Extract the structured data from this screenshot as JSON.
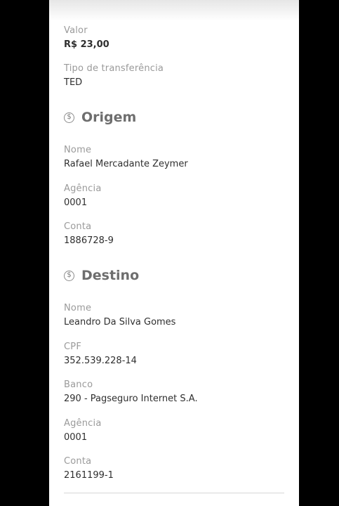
{
  "transfer": {
    "valor_label": "Valor",
    "valor": "R$ 23,00",
    "tipo_label": "Tipo de transferência",
    "tipo": "TED"
  },
  "origem": {
    "title": "Origem",
    "icon": "dollar-circle-icon",
    "nome_label": "Nome",
    "nome": "Rafael Mercadante Zeymer",
    "agencia_label": "Agência",
    "agencia": "0001",
    "conta_label": "Conta",
    "conta": "1886728-9"
  },
  "destino": {
    "title": "Destino",
    "icon": "dollar-circle-icon",
    "nome_label": "Nome",
    "nome": "Leandro Da Silva Gomes",
    "cpf_label": "CPF",
    "cpf": "352.539.228-14",
    "banco_label": "Banco",
    "banco": "290 - Pagseguro Internet S.A.",
    "agencia_label": "Agência",
    "agencia": "0001",
    "conta_label": "Conta",
    "conta": "2161199-1"
  }
}
